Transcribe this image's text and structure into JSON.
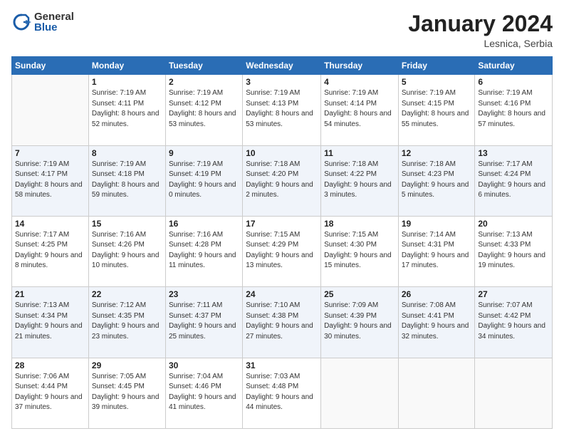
{
  "header": {
    "logo_general": "General",
    "logo_blue": "Blue",
    "month_title": "January 2024",
    "location": "Lesnica, Serbia"
  },
  "weekdays": [
    "Sunday",
    "Monday",
    "Tuesday",
    "Wednesday",
    "Thursday",
    "Friday",
    "Saturday"
  ],
  "weeks": [
    [
      {
        "day": "",
        "sunrise": "",
        "sunset": "",
        "daylight": ""
      },
      {
        "day": "1",
        "sunrise": "Sunrise: 7:19 AM",
        "sunset": "Sunset: 4:11 PM",
        "daylight": "Daylight: 8 hours and 52 minutes."
      },
      {
        "day": "2",
        "sunrise": "Sunrise: 7:19 AM",
        "sunset": "Sunset: 4:12 PM",
        "daylight": "Daylight: 8 hours and 53 minutes."
      },
      {
        "day": "3",
        "sunrise": "Sunrise: 7:19 AM",
        "sunset": "Sunset: 4:13 PM",
        "daylight": "Daylight: 8 hours and 53 minutes."
      },
      {
        "day": "4",
        "sunrise": "Sunrise: 7:19 AM",
        "sunset": "Sunset: 4:14 PM",
        "daylight": "Daylight: 8 hours and 54 minutes."
      },
      {
        "day": "5",
        "sunrise": "Sunrise: 7:19 AM",
        "sunset": "Sunset: 4:15 PM",
        "daylight": "Daylight: 8 hours and 55 minutes."
      },
      {
        "day": "6",
        "sunrise": "Sunrise: 7:19 AM",
        "sunset": "Sunset: 4:16 PM",
        "daylight": "Daylight: 8 hours and 57 minutes."
      }
    ],
    [
      {
        "day": "7",
        "sunrise": "Sunrise: 7:19 AM",
        "sunset": "Sunset: 4:17 PM",
        "daylight": "Daylight: 8 hours and 58 minutes."
      },
      {
        "day": "8",
        "sunrise": "Sunrise: 7:19 AM",
        "sunset": "Sunset: 4:18 PM",
        "daylight": "Daylight: 8 hours and 59 minutes."
      },
      {
        "day": "9",
        "sunrise": "Sunrise: 7:19 AM",
        "sunset": "Sunset: 4:19 PM",
        "daylight": "Daylight: 9 hours and 0 minutes."
      },
      {
        "day": "10",
        "sunrise": "Sunrise: 7:18 AM",
        "sunset": "Sunset: 4:20 PM",
        "daylight": "Daylight: 9 hours and 2 minutes."
      },
      {
        "day": "11",
        "sunrise": "Sunrise: 7:18 AM",
        "sunset": "Sunset: 4:22 PM",
        "daylight": "Daylight: 9 hours and 3 minutes."
      },
      {
        "day": "12",
        "sunrise": "Sunrise: 7:18 AM",
        "sunset": "Sunset: 4:23 PM",
        "daylight": "Daylight: 9 hours and 5 minutes."
      },
      {
        "day": "13",
        "sunrise": "Sunrise: 7:17 AM",
        "sunset": "Sunset: 4:24 PM",
        "daylight": "Daylight: 9 hours and 6 minutes."
      }
    ],
    [
      {
        "day": "14",
        "sunrise": "Sunrise: 7:17 AM",
        "sunset": "Sunset: 4:25 PM",
        "daylight": "Daylight: 9 hours and 8 minutes."
      },
      {
        "day": "15",
        "sunrise": "Sunrise: 7:16 AM",
        "sunset": "Sunset: 4:26 PM",
        "daylight": "Daylight: 9 hours and 10 minutes."
      },
      {
        "day": "16",
        "sunrise": "Sunrise: 7:16 AM",
        "sunset": "Sunset: 4:28 PM",
        "daylight": "Daylight: 9 hours and 11 minutes."
      },
      {
        "day": "17",
        "sunrise": "Sunrise: 7:15 AM",
        "sunset": "Sunset: 4:29 PM",
        "daylight": "Daylight: 9 hours and 13 minutes."
      },
      {
        "day": "18",
        "sunrise": "Sunrise: 7:15 AM",
        "sunset": "Sunset: 4:30 PM",
        "daylight": "Daylight: 9 hours and 15 minutes."
      },
      {
        "day": "19",
        "sunrise": "Sunrise: 7:14 AM",
        "sunset": "Sunset: 4:31 PM",
        "daylight": "Daylight: 9 hours and 17 minutes."
      },
      {
        "day": "20",
        "sunrise": "Sunrise: 7:13 AM",
        "sunset": "Sunset: 4:33 PM",
        "daylight": "Daylight: 9 hours and 19 minutes."
      }
    ],
    [
      {
        "day": "21",
        "sunrise": "Sunrise: 7:13 AM",
        "sunset": "Sunset: 4:34 PM",
        "daylight": "Daylight: 9 hours and 21 minutes."
      },
      {
        "day": "22",
        "sunrise": "Sunrise: 7:12 AM",
        "sunset": "Sunset: 4:35 PM",
        "daylight": "Daylight: 9 hours and 23 minutes."
      },
      {
        "day": "23",
        "sunrise": "Sunrise: 7:11 AM",
        "sunset": "Sunset: 4:37 PM",
        "daylight": "Daylight: 9 hours and 25 minutes."
      },
      {
        "day": "24",
        "sunrise": "Sunrise: 7:10 AM",
        "sunset": "Sunset: 4:38 PM",
        "daylight": "Daylight: 9 hours and 27 minutes."
      },
      {
        "day": "25",
        "sunrise": "Sunrise: 7:09 AM",
        "sunset": "Sunset: 4:39 PM",
        "daylight": "Daylight: 9 hours and 30 minutes."
      },
      {
        "day": "26",
        "sunrise": "Sunrise: 7:08 AM",
        "sunset": "Sunset: 4:41 PM",
        "daylight": "Daylight: 9 hours and 32 minutes."
      },
      {
        "day": "27",
        "sunrise": "Sunrise: 7:07 AM",
        "sunset": "Sunset: 4:42 PM",
        "daylight": "Daylight: 9 hours and 34 minutes."
      }
    ],
    [
      {
        "day": "28",
        "sunrise": "Sunrise: 7:06 AM",
        "sunset": "Sunset: 4:44 PM",
        "daylight": "Daylight: 9 hours and 37 minutes."
      },
      {
        "day": "29",
        "sunrise": "Sunrise: 7:05 AM",
        "sunset": "Sunset: 4:45 PM",
        "daylight": "Daylight: 9 hours and 39 minutes."
      },
      {
        "day": "30",
        "sunrise": "Sunrise: 7:04 AM",
        "sunset": "Sunset: 4:46 PM",
        "daylight": "Daylight: 9 hours and 41 minutes."
      },
      {
        "day": "31",
        "sunrise": "Sunrise: 7:03 AM",
        "sunset": "Sunset: 4:48 PM",
        "daylight": "Daylight: 9 hours and 44 minutes."
      },
      {
        "day": "",
        "sunrise": "",
        "sunset": "",
        "daylight": ""
      },
      {
        "day": "",
        "sunrise": "",
        "sunset": "",
        "daylight": ""
      },
      {
        "day": "",
        "sunrise": "",
        "sunset": "",
        "daylight": ""
      }
    ]
  ]
}
